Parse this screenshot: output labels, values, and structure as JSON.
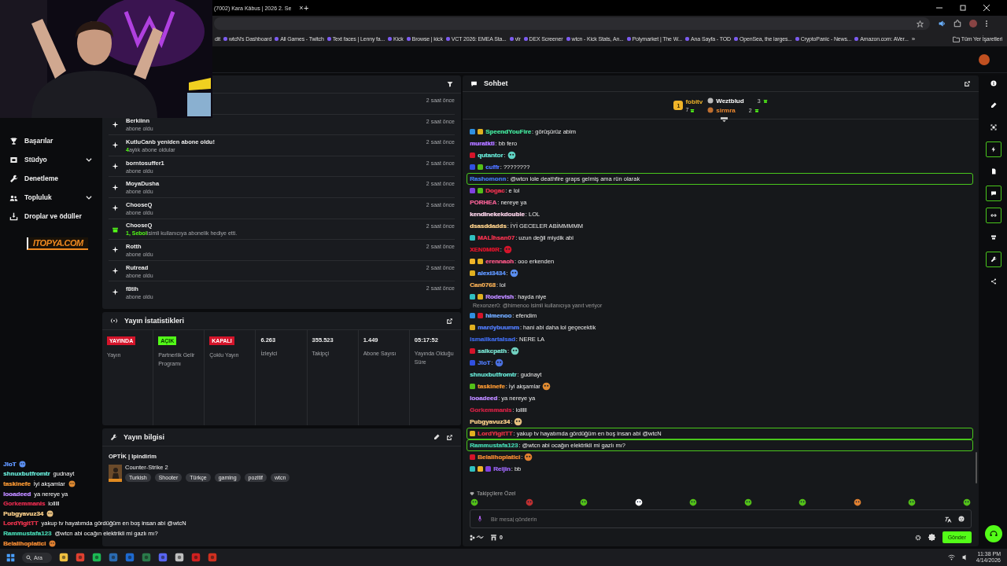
{
  "browser": {
    "tab": {
      "title": "(7002) Kara Kâbus | 2026 2. Se",
      "close": "×"
    },
    "new_tab": "+",
    "bookmarks": [
      {
        "label": "dit"
      },
      {
        "label": "wtcN's Dashboard"
      },
      {
        "label": "All Games - Twitch"
      },
      {
        "label": "Text faces | Lenny fa..."
      },
      {
        "label": "Kick"
      },
      {
        "label": "Browse | kick"
      },
      {
        "label": "VCT 2026: EMEA Sta..."
      },
      {
        "label": "vlr"
      },
      {
        "label": "DEX Screener"
      },
      {
        "label": "wtcn - Kick Stats, An..."
      },
      {
        "label": "Polymarket | The W..."
      },
      {
        "label": "Ana Sayfa - TOD"
      },
      {
        "label": "OpenSea, the larges..."
      },
      {
        "label": "CryptoPanic - News..."
      },
      {
        "label": "Amazon.com: AVer..."
      }
    ],
    "more": "»",
    "all_bookmarks": "Tüm Yer İşaretleri"
  },
  "sidebar": {
    "items": [
      {
        "label": "Başarılar"
      },
      {
        "label": "Stüdyo",
        "expanded": false
      },
      {
        "label": "Denetleme"
      },
      {
        "label": "Topluluk",
        "expanded": false
      },
      {
        "label": "Droplar ve ödüller"
      }
    ]
  },
  "overlay": {
    "logo": "ITOPYA.COM",
    "chat": [
      {
        "user": "JloT",
        "color": "#5a8ef0",
        "emote": true
      },
      {
        "user": "shnuxbutfromtr",
        "color": "#5fd4c4",
        "text": "gudnayt"
      },
      {
        "user": "taskinefe",
        "color": "#e08a30",
        "text": "İyi akşamlar",
        "emote": true
      },
      {
        "user": "looadeed",
        "color": "#b080f0",
        "text": "ya nereye ya"
      },
      {
        "user": "Gorkemmanis",
        "color": "#d02848",
        "text": "lolllll"
      },
      {
        "user": "Pubgyavuz34",
        "color": "#e8c080",
        "emote": true
      },
      {
        "user": "LordYigitTT",
        "color": "#d83048",
        "text": "yakup tv hayatımda gördüğüm en boş insan abi @wtcN"
      },
      {
        "user": "Rammustafa123",
        "color": "#40c0a0",
        "text": "@wtcn abi ocağın elektrikli mi gazlı mı?"
      },
      {
        "user": "Belalihoplatici",
        "color": "#e08030",
        "emote": true
      }
    ]
  },
  "feed": {
    "items": [
      {
        "time": "2 saat önce"
      },
      {
        "kind": "sub",
        "name": "Berkiinn",
        "detail": "abone oldu",
        "time": "2 saat önce"
      },
      {
        "kind": "resub",
        "name": "KutluCanb yeniden abone oldu!",
        "highlight": "4",
        "detail": "aylık abone oldular",
        "time": "2 saat önce"
      },
      {
        "kind": "sub",
        "name": "borntosuffer1",
        "detail": "abone oldu",
        "time": "2 saat önce"
      },
      {
        "kind": "sub",
        "name": "MoyaDusha",
        "detail": "abone oldu",
        "time": "2 saat önce"
      },
      {
        "kind": "sub",
        "name": "ChooseQ",
        "detail": "abone oldu",
        "time": "2 saat önce"
      },
      {
        "kind": "gift",
        "name": "ChooseQ",
        "highlight": "1, Sebol",
        "detail": "isimli kullanıcıya abonelik hediye etti.",
        "time": "2 saat önce"
      },
      {
        "kind": "sub",
        "name": "Rotth",
        "detail": "abone oldu",
        "time": "2 saat önce"
      },
      {
        "kind": "sub",
        "name": "Rutread",
        "detail": "abone oldu",
        "time": "2 saat önce"
      },
      {
        "kind": "sub",
        "name": "f8tih",
        "detail": "abone oldu",
        "time": "2 saat önce"
      }
    ]
  },
  "stats": {
    "title": "Yayın İstatistikleri",
    "cells": [
      {
        "kind": "status",
        "badge": "YAYINDA",
        "color": "#d4142a",
        "label": "Yayın"
      },
      {
        "kind": "status",
        "badge": "AÇIK",
        "color": "#53fc18",
        "label": "Partnerlik Gelir Programı"
      },
      {
        "kind": "status",
        "badge": "KAPALI",
        "color": "#d4142a",
        "label": "Çoklu Yayın"
      },
      {
        "kind": "value",
        "value": "6.263",
        "label": "İzleyici"
      },
      {
        "kind": "value",
        "value": "355.523",
        "label": "Takipçi"
      },
      {
        "kind": "value",
        "value": "1.449",
        "label": "Abone Sayısı"
      },
      {
        "kind": "value",
        "value": "05:17:52",
        "label": "Yayında Olduğu Süre"
      }
    ]
  },
  "stream_info": {
    "title": "Yayın bilgisi",
    "stream_title": "OPTİK | Ipindirim",
    "game": "Counter-Strike 2",
    "tags": [
      "Turkish",
      "Shooter",
      "Türkçe",
      "gaming",
      "pozitif",
      "wtcn"
    ]
  },
  "chat": {
    "title": "Sohbet",
    "leaders": [
      {
        "rank": "1",
        "name": "fobitv",
        "count": "7",
        "color": "#f0b429"
      },
      {
        "name": "Weztblud",
        "count": "3",
        "color": "#ffffff"
      },
      {
        "name": "sirmra",
        "count": "2",
        "color": "#f08a30"
      }
    ],
    "messages": [
      {
        "user": "SpeendYouFire",
        "color": "#3ecf8e",
        "text": ": görüşürüz abim",
        "badges": [
          {
            "color": "#2f8fe0"
          },
          {
            "color": "#e0b020"
          }
        ]
      },
      {
        "user": "muratkti",
        "color": "#a970ff",
        "text": ": bb fero"
      },
      {
        "user": "qutantor",
        "color": "#5fd4c4",
        "text": ":",
        "emote": true,
        "badges": [
          {
            "color": "#d4142a"
          }
        ]
      },
      {
        "user": "cuffr",
        "color": "#4a6cf0",
        "text": ": ????????",
        "badges": [
          {
            "color": "#3050e0"
          },
          {
            "color": "#53c018"
          }
        ]
      },
      {
        "user": "Rashomonn",
        "color": "#3b6fd8",
        "text": ": @wtcn lole deathfire graps gelmiş ama rün olarak",
        "highlighted": true
      },
      {
        "user": "Dogac",
        "color": "#d6304a",
        "text": ": e lol",
        "badges": [
          {
            "color": "#8040e0"
          },
          {
            "color": "#53c018"
          }
        ]
      },
      {
        "user": "PORHEA",
        "color": "#e05a8a",
        "text": ": nereye ya"
      },
      {
        "user": "kendinekekdouble",
        "color": "#e8c3d8",
        "text": ": LOL"
      },
      {
        "user": "dsasddadds",
        "color": "#e8c080",
        "text": ": İYİ GECELER ABİMMMMM"
      },
      {
        "user": "MALİhsan07",
        "color": "#e0304a",
        "text": ": uzun değil miydik abi",
        "badges": [
          {
            "color": "#30c0c0"
          }
        ]
      },
      {
        "user": "XEN0M0R",
        "color": "#d4142a",
        "text": ":",
        "emote": true
      },
      {
        "user": "erennaoh",
        "color": "#e0507a",
        "text": ": ooo erkenden",
        "badges": [
          {
            "color": "#f0b429"
          },
          {
            "color": "#e0b020"
          }
        ]
      },
      {
        "user": "alexi3434",
        "color": "#5a8ef0",
        "text": ":",
        "emote": true,
        "badges": [
          {
            "color": "#e0b020"
          }
        ]
      },
      {
        "user": "Can0768",
        "color": "#e0a050",
        "text": ": lol"
      },
      {
        "user": "Rodevish",
        "color": "#b080f0",
        "text": ": hayda niye",
        "badges": [
          {
            "color": "#30c0c0"
          },
          {
            "color": "#e0b020"
          }
        ]
      },
      {
        "reply": "Rexonzer0: @himenoo isimli kullanıcıya yanıt veriyor",
        "user": "himenoo",
        "color": "#6aa0f0",
        "text": ": efendim",
        "badges": [
          {
            "color": "#2f8fe0"
          },
          {
            "color": "#d4142a"
          }
        ]
      },
      {
        "user": "mardybuumm",
        "color": "#4a70e0",
        "text": ": hani abi daha lol geçecektik",
        "badges": [
          {
            "color": "#e0b020"
          }
        ]
      },
      {
        "user": "ismailkartalsad",
        "color": "#3a60d0",
        "text": ": NERE LA"
      },
      {
        "user": "saikcpath",
        "color": "#70d0c0",
        "text": ":",
        "emote": true,
        "badges": [
          {
            "color": "#d4142a"
          }
        ]
      },
      {
        "user": "JloT",
        "color": "#4a70e0",
        "text": ":",
        "emote": true,
        "badges": [
          {
            "color": "#3050e0"
          }
        ]
      },
      {
        "user": "shnuxbutfromtr",
        "color": "#5fd4c4",
        "text": ": gudnayt"
      },
      {
        "user": "taskinefe",
        "color": "#e08a30",
        "text": ": İyi akşamlar",
        "emote": true,
        "badges": [
          {
            "color": "#53c018"
          }
        ]
      },
      {
        "user": "looadeed",
        "color": "#b080f0",
        "text": ": ya nereye ya"
      },
      {
        "user": "Gorkemmanis",
        "color": "#c02040",
        "text": ": lolllll"
      },
      {
        "user": "Pubgyavuz34",
        "color": "#e8c080",
        "text": ":",
        "emote": true
      },
      {
        "user": "LordYigitTT",
        "color": "#d03040",
        "text": ": yakup tv hayatımda gördüğüm en boş insan abi @wtcN",
        "highlighted": true,
        "badges": [
          {
            "color": "#e0b020"
          }
        ]
      },
      {
        "user": "Rammustafa123",
        "color": "#40c0a0",
        "text": ": @wtcn abi ocağın elektrikli mi gazlı mı?",
        "highlighted": true
      },
      {
        "user": "Belalihoplatici",
        "color": "#e08030",
        "text": ":",
        "emote": true,
        "badges": [
          {
            "color": "#d4142a"
          }
        ]
      },
      {
        "user": "Reijin",
        "color": "#9060e0",
        "text": ": bb",
        "badges": [
          {
            "color": "#30c0c0"
          },
          {
            "color": "#f0b429"
          },
          {
            "color": "#8040e0"
          }
        ]
      }
    ],
    "followers_only": "Takipçilere Özel",
    "input": {
      "placeholder": "Bir mesaj gönderin"
    },
    "points": "0",
    "send": "Gönder"
  },
  "rail": [
    {
      "on": false
    },
    {
      "on": false
    },
    {
      "on": false
    },
    {
      "on": true
    },
    {
      "on": false
    },
    {
      "on": true
    },
    {
      "on": true
    },
    {
      "on": false
    },
    {
      "on": true
    },
    {
      "on": false
    }
  ],
  "taskbar": {
    "search": "Ara",
    "time": "11:38 PM",
    "date": "4/14/2026"
  }
}
